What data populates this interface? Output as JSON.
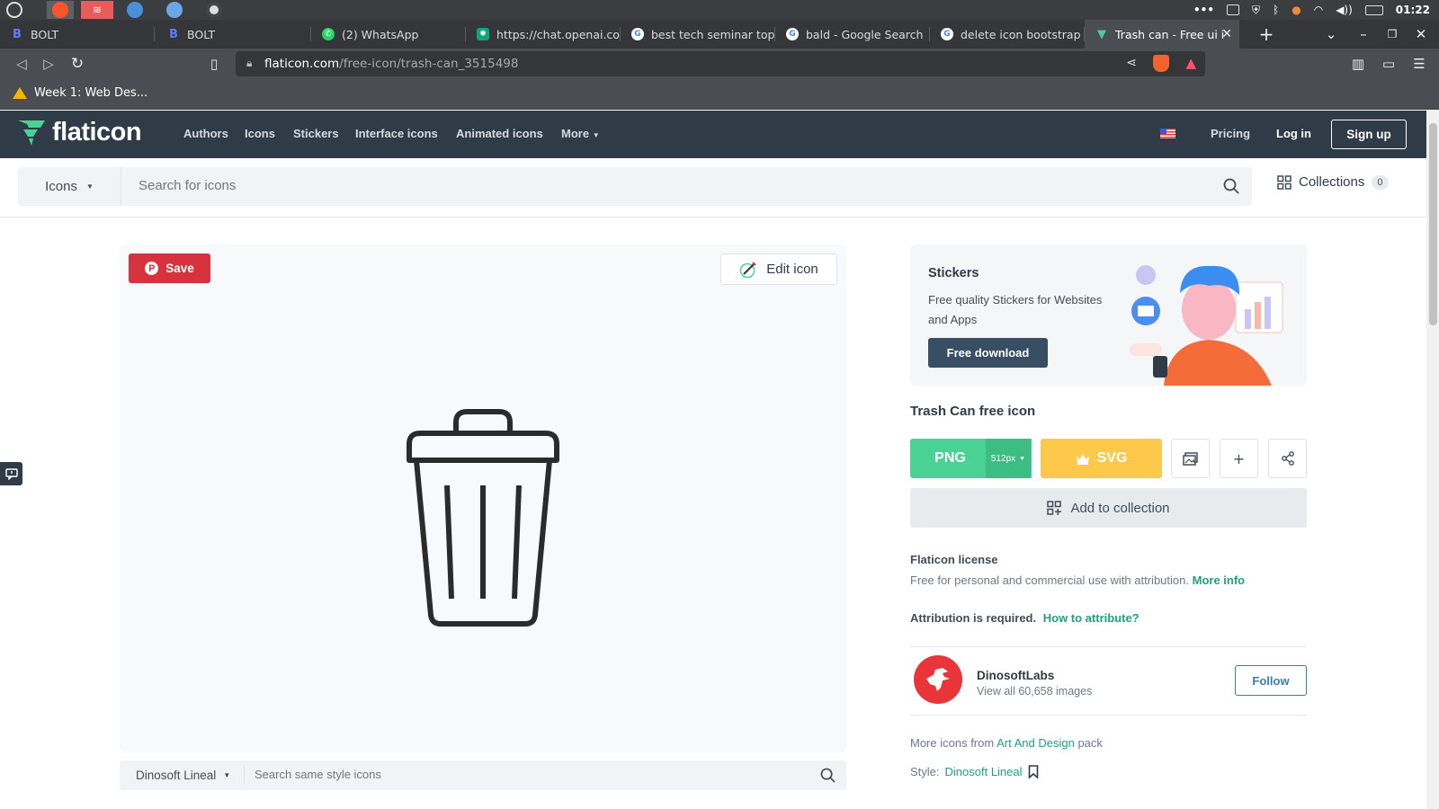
{
  "os": {
    "clock": "01:22",
    "tray_icons": [
      "dots-icon",
      "clipboard-icon",
      "shield-icon",
      "bluetooth-icon",
      "vpn-icon",
      "wifi-icon",
      "volume-icon",
      "battery-icon"
    ]
  },
  "browser": {
    "tabs": [
      {
        "title": "BOLT",
        "favicon": "B",
        "color": "#3b5bdb"
      },
      {
        "title": "BOLT",
        "favicon": "B",
        "color": "#3b5bdb"
      },
      {
        "title": "(2) WhatsApp",
        "favicon": "W",
        "color": "#25d366"
      },
      {
        "title": "https://chat.openai.com",
        "favicon": "O",
        "color": "#10a37f"
      },
      {
        "title": "best tech seminar topic",
        "favicon": "G",
        "color": "#ffffff"
      },
      {
        "title": "bald - Google Search",
        "favicon": "G",
        "color": "#ffffff"
      },
      {
        "title": "delete icon bootstrap",
        "favicon": "G",
        "color": "#ffffff"
      },
      {
        "title": "Trash can - Free ui i",
        "favicon": "F",
        "color": "#4ad295",
        "active": true
      }
    ],
    "url_host": "flaticon.com",
    "url_path": "/free-icon/trash-can_3515498",
    "bookmark": "Week 1: Web Des..."
  },
  "header": {
    "logo": "flaticon",
    "nav": [
      "Authors",
      "Icons",
      "Stickers",
      "Interface icons",
      "Animated icons",
      "More"
    ],
    "pricing": "Pricing",
    "login": "Log in",
    "signup": "Sign up"
  },
  "search": {
    "type": "Icons",
    "placeholder": "Search for icons",
    "collections_label": "Collections",
    "collections_count": "0"
  },
  "preview": {
    "save_label": "Save",
    "edit_label": "Edit icon",
    "style_name": "Dinosoft Lineal",
    "style_placeholder": "Search same style icons"
  },
  "stickers": {
    "title": "Stickers",
    "description": "Free quality Stickers for Websites and Apps",
    "button": "Free download"
  },
  "icon_detail": {
    "title": "Trash Can free icon",
    "png_label": "PNG",
    "png_size": "512px",
    "svg_label": "SVG",
    "add_collection": "Add to collection",
    "license_title": "Flaticon license",
    "license_desc": "Free for personal and commercial use with attribution.",
    "more_info": "More info",
    "attribution": "Attribution is required.",
    "how_to": "How to attribute?",
    "author_name": "DinosoftLabs",
    "author_sub": "View all 60,658 images",
    "follow": "Follow",
    "more_from_prefix": "More icons from",
    "pack_name": "Art And Design",
    "more_from_suffix": "pack",
    "style_label": "Style:",
    "style_name": "Dinosoft Lineal"
  },
  "colors": {
    "header_bg": "#2f3b47",
    "png_green": "#4ad295",
    "svg_yellow": "#fec84b",
    "pinterest_red": "#d7333f",
    "link_green": "#1ea27d"
  }
}
